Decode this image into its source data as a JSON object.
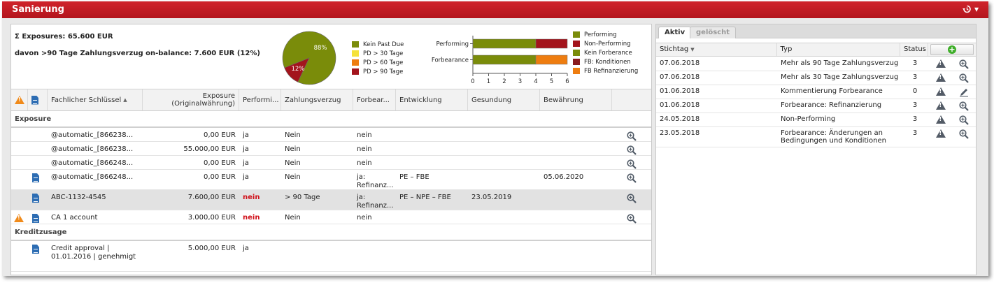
{
  "app": {
    "title": "Sanierung",
    "history_icon": "history-icon",
    "history_arrow": "▾"
  },
  "summary": {
    "exposures": "Σ Exposures: 65.600 EUR",
    "overdue": "davon >90 Tage Zahlungsverzug on-balance: 7.600 EUR (12%)"
  },
  "pie_chart": {
    "type": "pie",
    "slices": [
      {
        "label": "Kein Past Due",
        "value": 88,
        "color": "#7a8c0a"
      },
      {
        "label": "PD > 90 Tage",
        "value": 12,
        "color": "#a3141c"
      }
    ],
    "slice_labels": [
      "88%",
      "12%"
    ],
    "legend": [
      {
        "label": "Kein Past Due",
        "color": "#7a8c0a"
      },
      {
        "label": "PD > 30 Tage",
        "color": "#f5e23a"
      },
      {
        "label": "PD > 60 Tage",
        "color": "#ee7d10"
      },
      {
        "label": "PD > 90 Tage",
        "color": "#a3141c"
      }
    ]
  },
  "chart_data": {
    "type": "bar",
    "orientation": "horizontal",
    "stacked": true,
    "categories": [
      "Performing",
      "Forbearance"
    ],
    "series": [
      {
        "name": "Performing",
        "values": [
          4,
          null
        ],
        "color": "#7a8c0a"
      },
      {
        "name": "Non-Performing",
        "values": [
          2,
          null
        ],
        "color": "#a3141c"
      },
      {
        "name": "Kein Forberance",
        "values": [
          null,
          4
        ],
        "color": "#7a8c0a"
      },
      {
        "name": "FB: Konditionen",
        "values": [
          null,
          0
        ],
        "color": "#8a1b1e"
      },
      {
        "name": "FB Refinanzierung",
        "values": [
          null,
          2
        ],
        "color": "#ee7d10"
      }
    ],
    "xlim": [
      0,
      6
    ],
    "xticks": [
      "0",
      "1",
      "2",
      "3",
      "4",
      "5",
      "6"
    ],
    "legend_position": "right"
  },
  "bar_legend": [
    {
      "label": "Performing",
      "color": "#7a8c0a"
    },
    {
      "label": "Non-Performing",
      "color": "#a3141c"
    },
    {
      "label": "Kein Forberance",
      "color": "#7a8c0a"
    },
    {
      "label": "FB: Konditionen",
      "color": "#8a1b1e"
    },
    {
      "label": "FB Refinanzierung",
      "color": "#ee7d10"
    }
  ],
  "grid": {
    "headers": {
      "key": "Fachlicher Schlüssel",
      "exposure": "Exposure (Originalwährung)",
      "performing": "Performi...",
      "zahlungsverzug": "Zahlungsverzug",
      "forbearance": "Forbear...",
      "entwicklung": "Entwicklung",
      "gesundung": "Gesundung",
      "bewaehrung": "Bewährung"
    },
    "groups": [
      {
        "label": "Exposure",
        "rows": [
          {
            "warn": false,
            "doc": false,
            "key": "@automatic_[866238...",
            "exposure": "0,00 EUR",
            "perf": "ja",
            "perf_red": false,
            "zv": "Nein",
            "fb": "nein",
            "ent": "",
            "ges": "",
            "bew": "",
            "selected": false
          },
          {
            "warn": false,
            "doc": false,
            "key": "@automatic_[866238...",
            "exposure": "55.000,00 EUR",
            "perf": "ja",
            "perf_red": false,
            "zv": "Nein",
            "fb": "nein",
            "ent": "",
            "ges": "",
            "bew": "",
            "selected": false
          },
          {
            "warn": false,
            "doc": false,
            "key": "@automatic_[866248...",
            "exposure": "0,00 EUR",
            "perf": "ja",
            "perf_red": false,
            "zv": "Nein",
            "fb": "nein",
            "ent": "",
            "ges": "",
            "bew": "",
            "selected": false
          },
          {
            "warn": false,
            "doc": true,
            "key": "@automatic_[866248...",
            "exposure": "0,00 EUR",
            "perf": "ja",
            "perf_red": false,
            "zv": "Nein",
            "fb": "ja: Refinanz...",
            "ent": "PE – FBE",
            "ges": "",
            "bew": "05.06.2020",
            "selected": false
          },
          {
            "warn": false,
            "doc": true,
            "key": "ABC-1132-4545",
            "exposure": "7.600,00 EUR",
            "perf": "nein",
            "perf_red": true,
            "zv": "> 90 Tage",
            "fb": "ja: Refinanz...",
            "ent": "PE – NPE – FBE",
            "ges": "23.05.2019",
            "bew": "",
            "selected": true
          },
          {
            "warn": true,
            "doc": true,
            "key": "CA 1 account",
            "exposure": "3.000,00 EUR",
            "perf": "nein",
            "perf_red": true,
            "zv": "Nein",
            "fb": "nein",
            "ent": "",
            "ges": "",
            "bew": "",
            "selected": false
          }
        ]
      },
      {
        "label": "Kreditzusage",
        "rows": [
          {
            "warn": false,
            "doc": true,
            "key": "Credit approval | 01.01.2016 | genehmigt",
            "exposure": "5.000,00 EUR",
            "perf": "ja",
            "perf_red": false,
            "zv": "",
            "fb": "",
            "ent": "",
            "ges": "",
            "bew": "",
            "selected": false,
            "no_action": true
          }
        ]
      }
    ]
  },
  "right": {
    "tabs": [
      "Aktiv",
      "gelöscht"
    ],
    "headers": {
      "stichtag": "Stichtag",
      "typ": "Typ",
      "status": "Status"
    },
    "rows": [
      {
        "date": "07.06.2018",
        "typ": "Mehr als 90 Tage Zahlungsverzug",
        "status": "3",
        "action": "zoom"
      },
      {
        "date": "07.06.2018",
        "typ": "Mehr als 30 Tage Zahlungsverzug",
        "status": "3",
        "action": "zoom"
      },
      {
        "date": "01.06.2018",
        "typ": "Kommentierung Forbearance",
        "status": "0",
        "action": "edit"
      },
      {
        "date": "01.06.2018",
        "typ": "Forbearance: Refinanzierung",
        "status": "3",
        "action": "zoom"
      },
      {
        "date": "24.05.2018",
        "typ": "Non-Performing",
        "status": "3",
        "action": "zoom"
      },
      {
        "date": "23.05.2018",
        "typ": "Forbearance: Änderungen an Bedingungen und Konditionen",
        "status": "3",
        "action": "zoom"
      }
    ]
  }
}
